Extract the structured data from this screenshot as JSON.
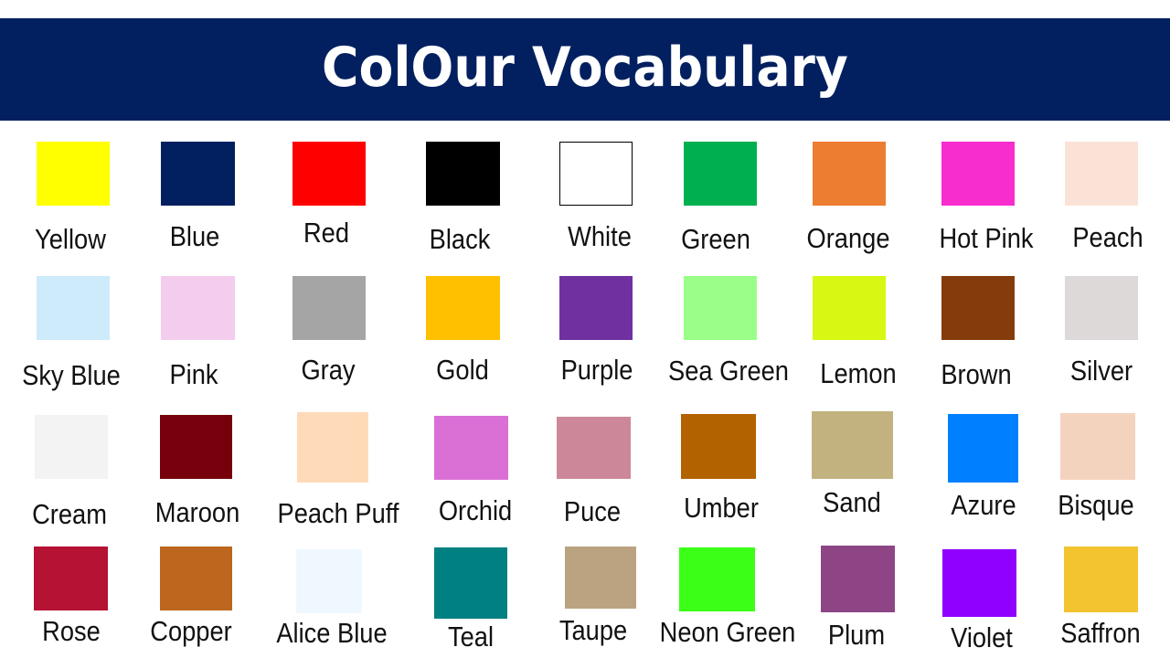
{
  "header": {
    "title": "ColOur Vocabulary",
    "background": "#022060"
  },
  "colors": [
    {
      "name": "Yellow",
      "hex": "#FFFF00"
    },
    {
      "name": "Blue",
      "hex": "#022060"
    },
    {
      "name": "Red",
      "hex": "#FF0000"
    },
    {
      "name": "Black",
      "hex": "#000000"
    },
    {
      "name": "White",
      "hex": "#FFFFFF"
    },
    {
      "name": "Green",
      "hex": "#00B050"
    },
    {
      "name": "Orange",
      "hex": "#ED7D31"
    },
    {
      "name": "Hot Pink",
      "hex": "#F72DCE"
    },
    {
      "name": "Peach",
      "hex": "#FAE3D6"
    },
    {
      "name": "Sky Blue",
      "hex": "#CDEBFB"
    },
    {
      "name": "Pink",
      "hex": "#F4CCEE"
    },
    {
      "name": "Gray",
      "hex": "#A5A5A5"
    },
    {
      "name": "Gold",
      "hex": "#FFC000"
    },
    {
      "name": "Purple",
      "hex": "#7030A0"
    },
    {
      "name": "Sea Green",
      "hex": "#99FF88"
    },
    {
      "name": "Lemon",
      "hex": "#D8F712"
    },
    {
      "name": "Brown",
      "hex": "#843C0C"
    },
    {
      "name": "Silver",
      "hex": "#DDD9D9"
    },
    {
      "name": "Cream",
      "hex": "#F3F3F3"
    },
    {
      "name": "Maroon",
      "hex": "#76000B"
    },
    {
      "name": "Peach Puff",
      "hex": "#FFDAB9"
    },
    {
      "name": "Orchid",
      "hex": "#DA70D6"
    },
    {
      "name": "Puce",
      "hex": "#CC8899"
    },
    {
      "name": "Umber",
      "hex": "#B36200"
    },
    {
      "name": "Sand",
      "hex": "#C2B280"
    },
    {
      "name": "Azure",
      "hex": "#0080FF"
    },
    {
      "name": "Bisque",
      "hex": "#F4D3BE"
    },
    {
      "name": "Rose",
      "hex": "#B51234"
    },
    {
      "name": "Copper",
      "hex": "#BC661E"
    },
    {
      "name": "Alice Blue",
      "hex": "#F0F8FF"
    },
    {
      "name": "Teal",
      "hex": "#008080"
    },
    {
      "name": "Taupe",
      "hex": "#BBA382"
    },
    {
      "name": "Neon Green",
      "hex": "#3BFF17"
    },
    {
      "name": "Plum",
      "hex": "#8E4585"
    },
    {
      "name": "Violet",
      "hex": "#8F00FF"
    },
    {
      "name": "Saffron",
      "hex": "#F4C430"
    }
  ]
}
